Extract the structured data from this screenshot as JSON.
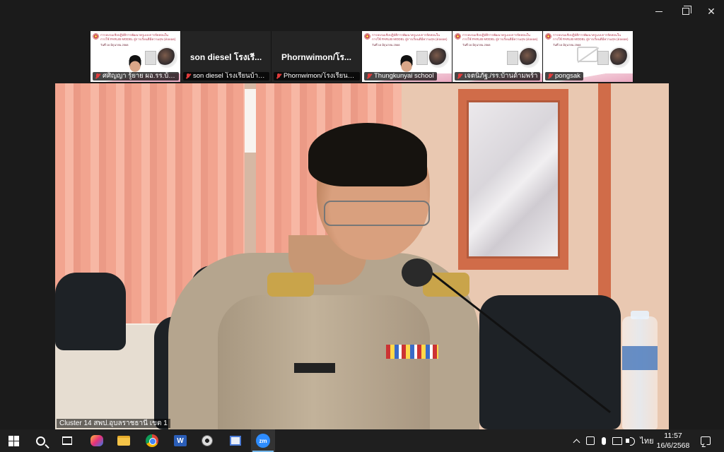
{
  "participants": [
    {
      "name": "ศศิญญา รู้ยาย ผอ.รร.บ้า...",
      "type": "slide"
    },
    {
      "name": "son diesel โรงเรียนบ้าน...",
      "big_name": "son diesel โรงเรี...",
      "type": "name"
    },
    {
      "name": "Phornwimon/โรงเรียนบ้...",
      "big_name": "Phornwimon/โร...",
      "type": "name"
    },
    {
      "name": "Thungkunyai school",
      "type": "slide"
    },
    {
      "name": "เจตนิภัฐ./รร.บ้านด้ามพร้า",
      "type": "slide"
    },
    {
      "name": "pongsak",
      "type": "slide-camoff"
    }
  ],
  "slide_text": {
    "title_line1": "การอบรมเชิงปฏิบัติการพัฒนาครูแบบการจัดสอนใน",
    "title_line2": "การใช้ PARLIB MODEL สู่การเรียนดีมีความสุข (ต่อยอด)",
    "date": "วันที่ 16 มิถุนายน 2568"
  },
  "main_video": {
    "label": "Cluster 14 สพป.อุบลราชธานี เขต 1"
  },
  "tray": {
    "language": "ไทย",
    "time": "11:57",
    "date": "16/6/2568"
  },
  "taskbar": {
    "word_label": "W",
    "zoom_label": "zm"
  },
  "colors": {
    "zoom_blue": "#2d8cff",
    "mic_off_red": "#e03b3b",
    "taskbar_bg": "#1f1f1f"
  }
}
